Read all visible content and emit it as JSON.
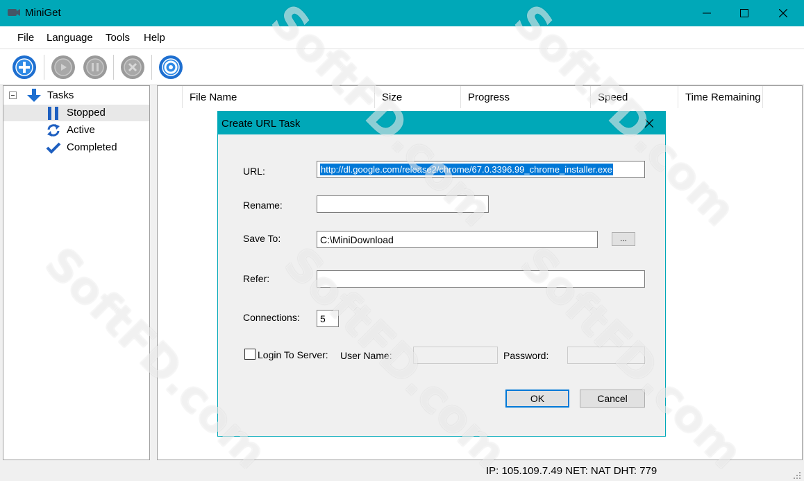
{
  "window": {
    "title": "MiniGet"
  },
  "menu": [
    "File",
    "Language",
    "Tools",
    "Help"
  ],
  "toolbar": {
    "buttons": [
      {
        "icon": "add-icon",
        "color": "#1e6fd0"
      },
      {
        "icon": "play-icon",
        "color": "#a0a0a0"
      },
      {
        "icon": "pause-icon",
        "color": "#a0a0a0"
      },
      {
        "icon": "stop-icon",
        "color": "#a0a0a0"
      },
      {
        "icon": "settings-icon",
        "color": "#1e6fd0"
      }
    ]
  },
  "tree": {
    "root": "Tasks",
    "items": [
      "Stopped",
      "Active",
      "Completed"
    ],
    "selected": "Stopped"
  },
  "columns": [
    "File Name",
    "Size",
    "Progress",
    "Speed",
    "Time Remaining"
  ],
  "status": {
    "text": "IP: 105.109.7.49 NET: NAT  DHT: 779"
  },
  "dialog": {
    "title": "Create URL Task",
    "url_label": "URL:",
    "url_value": "http://dl.google.com/release2/chrome/67.0.3396.99_chrome_installer.exe",
    "rename_label": "Rename:",
    "rename_value": "",
    "saveto_label": "Save To:",
    "saveto_value": "C:\\MiniDownload",
    "browse_label": "...",
    "refer_label": "Refer:",
    "refer_value": "",
    "connections_label": "Connections:",
    "connections_value": "5",
    "login_label": "Login To Server:",
    "login_checked": false,
    "username_label": "User Name:",
    "password_label": "Password:",
    "ok_label": "OK",
    "cancel_label": "Cancel"
  },
  "watermark": "SoftFD.com",
  "colors": {
    "accent": "#00a8b8",
    "selection": "#0078d7",
    "icon_blue": "#1e6fd0"
  }
}
